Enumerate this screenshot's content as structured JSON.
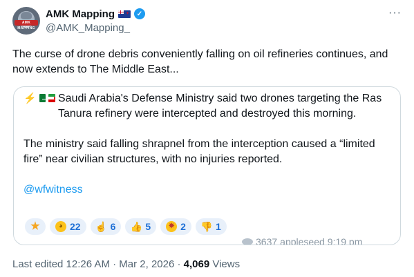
{
  "author": {
    "name": "AMK Mapping",
    "handle": "@AMK_Mapping_",
    "avatar_text": "AMK MAPPING",
    "flag_icon": "new-zealand-flag-icon",
    "verified_icon": "verified-badge-icon"
  },
  "more_label": "···",
  "tweet": {
    "text": "The curse of drone debris conveniently falling on oil refineries continues, and now extends to The Middle East..."
  },
  "quote": {
    "line1_icons": [
      "lightning-icon",
      "saudi-arabia-flag-icon",
      "iran-flag-icon"
    ],
    "para1": "Saudi Arabia's Defense Ministry said two drones targeting the Ras Tanura refinery were intercepted and destroyed this morning.",
    "para2": "The ministry said falling shrapnel from the interception caused a “limited fire” near civilian structures, with no injuries reported.",
    "link": "@wfwitness",
    "reactions": [
      {
        "icon": "star-icon",
        "count": ""
      },
      {
        "icon": "rofl-emoji-icon",
        "count": "22"
      },
      {
        "icon": "middle-finger-emoji-icon",
        "count": "6"
      },
      {
        "icon": "thumbs-up-emoji-icon",
        "count": "5"
      },
      {
        "icon": "mind-blown-emoji-icon",
        "count": "2"
      },
      {
        "icon": "thumbs-down-emoji-icon",
        "count": "1"
      }
    ],
    "views": "3637",
    "footer_author": "appleseed",
    "footer_time": "9:19 pm"
  },
  "meta": {
    "edited": "Last edited 12:26 AM · Mar 2, 2026 · ",
    "views_count": "4,069",
    "views_label": " Views"
  },
  "colors": {
    "accent": "#1d9bf0",
    "secondary_text": "#536471",
    "border": "#cfd9de"
  }
}
